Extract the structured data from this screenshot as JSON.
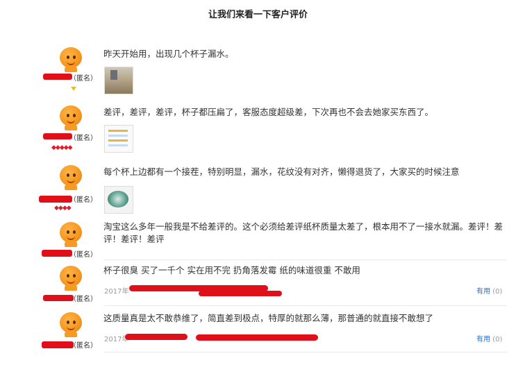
{
  "page": {
    "title": "让我们来看一下客户评价"
  },
  "anon_label": "（匿名）",
  "helpful_label": "有用",
  "helpful_count": "(0)",
  "year_prefix": "2017年",
  "reviews": [
    {
      "text": "昨天开始用，出现几个杯子漏水。"
    },
    {
      "text": "差评，差评，差评，杯子都压扁了，客服态度超级差，下次再也不会去她家买东西了。"
    },
    {
      "text": "每个杯上边都有一个接茬，特别明显，漏水，花纹没有对齐，懒得退货了，大家买的时候注意"
    },
    {
      "text": "淘宝这么多年一般我是不给差评的。这个必须给差评纸杯质量太差了，根本用不了一接水就漏。差评！差评！差评！差评"
    },
    {
      "text": "杯子很臭 买了一千个 实在用不完 扔角落发霉 纸的味道很重 不敢用"
    },
    {
      "text": "这质量真是太不敢恭维了，简直差到极点，特厚的就那么薄，那普通的就直接不敢想了"
    }
  ],
  "colors": {
    "redaction": "#e0101a",
    "link": "#2a6fc9",
    "avatar": "#f59a23"
  }
}
